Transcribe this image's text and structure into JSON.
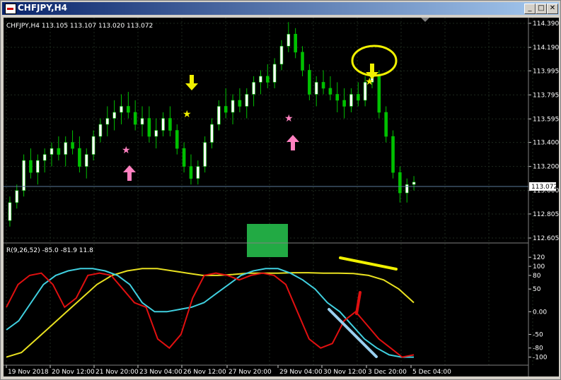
{
  "window": {
    "title": "CHFJPY,H4",
    "buttons": {
      "minimize": "_",
      "maximize": "□",
      "close": "✕"
    }
  },
  "main_chart": {
    "header": "CHFJPY,H4  113.105 113.107 113.020 113.072",
    "price_labels": [
      "114.390",
      "114.190",
      "113.995",
      "113.795",
      "113.595",
      "113.400",
      "113.200",
      "113.000",
      "112.805",
      "112.605"
    ],
    "current_price": "113.072"
  },
  "indicator": {
    "header": "R(9,26,52) -85.0 -81.9 11.8",
    "scale_labels": [
      "120",
      "100",
      "80",
      "50",
      "0.00",
      "-50",
      "-80",
      "-100"
    ]
  },
  "time_axis": [
    "19 Nov 2018",
    "20 Nov 12:00",
    "21 Nov 20:00",
    "23 Nov 04:00",
    "26 Nov 12:00",
    "27 Nov 20:00",
    "29 Nov 04:00",
    "30 Nov 12:00",
    "3 Dec 20:00",
    "5 Dec 04:00"
  ],
  "colors": {
    "background": "#000000",
    "grid": "#1e2a1e",
    "bull_candle": "#ffffff",
    "bear_candle": "#00c000",
    "wick": "#00c000",
    "osc_fast": "#e01010",
    "osc_mid": "#40d0e0",
    "osc_slow": "#e8e020",
    "arrow_up": "#ff80c0",
    "arrow_down": "#f0f000",
    "marker_box": "#22aa44"
  },
  "chart_data": {
    "type": "candlestick",
    "ylim": [
      112.605,
      114.39
    ],
    "candles": [
      [
        112.75,
        112.95,
        112.7,
        112.9
      ],
      [
        112.9,
        113.05,
        112.85,
        113.0
      ],
      [
        113.0,
        113.3,
        112.95,
        113.25
      ],
      [
        113.25,
        113.35,
        113.1,
        113.15
      ],
      [
        113.15,
        113.3,
        113.05,
        113.25
      ],
      [
        113.25,
        113.35,
        113.15,
        113.3
      ],
      [
        113.3,
        113.4,
        113.2,
        113.35
      ],
      [
        113.35,
        113.45,
        113.25,
        113.3
      ],
      [
        113.3,
        113.45,
        113.2,
        113.4
      ],
      [
        113.4,
        113.5,
        113.3,
        113.35
      ],
      [
        113.35,
        113.45,
        113.15,
        113.2
      ],
      [
        113.2,
        113.35,
        113.1,
        113.3
      ],
      [
        113.3,
        113.5,
        113.25,
        113.45
      ],
      [
        113.45,
        113.6,
        113.4,
        113.55
      ],
      [
        113.55,
        113.7,
        113.45,
        113.6
      ],
      [
        113.6,
        113.75,
        113.5,
        113.65
      ],
      [
        113.65,
        113.8,
        113.55,
        113.7
      ],
      [
        113.7,
        113.82,
        113.6,
        113.65
      ],
      [
        113.65,
        113.75,
        113.5,
        113.55
      ],
      [
        113.55,
        113.7,
        113.45,
        113.6
      ],
      [
        113.6,
        113.7,
        113.4,
        113.45
      ],
      [
        113.45,
        113.6,
        113.35,
        113.5
      ],
      [
        113.5,
        113.65,
        113.45,
        113.6
      ],
      [
        113.6,
        113.7,
        113.45,
        113.5
      ],
      [
        113.5,
        113.55,
        113.3,
        113.35
      ],
      [
        113.35,
        113.4,
        113.15,
        113.2
      ],
      [
        113.2,
        113.3,
        113.05,
        113.1
      ],
      [
        113.1,
        113.25,
        113.05,
        113.2
      ],
      [
        113.2,
        113.45,
        113.15,
        113.4
      ],
      [
        113.4,
        113.6,
        113.35,
        113.55
      ],
      [
        113.55,
        113.75,
        113.5,
        113.7
      ],
      [
        113.7,
        113.85,
        113.6,
        113.65
      ],
      [
        113.65,
        113.8,
        113.55,
        113.75
      ],
      [
        113.75,
        113.85,
        113.65,
        113.7
      ],
      [
        113.7,
        113.85,
        113.6,
        113.8
      ],
      [
        113.8,
        113.95,
        113.7,
        113.9
      ],
      [
        113.9,
        114.0,
        113.8,
        113.95
      ],
      [
        113.95,
        114.05,
        113.85,
        113.9
      ],
      [
        113.9,
        114.1,
        113.85,
        114.05
      ],
      [
        114.05,
        114.25,
        114.0,
        114.2
      ],
      [
        114.2,
        114.4,
        114.15,
        114.3
      ],
      [
        114.3,
        114.35,
        114.1,
        114.15
      ],
      [
        114.15,
        114.2,
        113.95,
        114.0
      ],
      [
        114.0,
        114.05,
        113.75,
        113.8
      ],
      [
        113.8,
        113.95,
        113.7,
        113.9
      ],
      [
        113.9,
        114.0,
        113.8,
        113.85
      ],
      [
        113.85,
        113.95,
        113.75,
        113.8
      ],
      [
        113.8,
        113.9,
        113.65,
        113.75
      ],
      [
        113.75,
        113.85,
        113.6,
        113.7
      ],
      [
        113.7,
        113.85,
        113.65,
        113.8
      ],
      [
        113.8,
        113.9,
        113.7,
        113.75
      ],
      [
        113.75,
        113.95,
        113.7,
        113.9
      ],
      [
        113.9,
        114.0,
        113.85,
        113.95
      ],
      [
        113.95,
        114.0,
        113.6,
        113.65
      ],
      [
        113.65,
        113.7,
        113.4,
        113.45
      ],
      [
        113.45,
        113.5,
        113.1,
        113.15
      ],
      [
        113.15,
        113.2,
        112.9,
        112.98
      ],
      [
        112.98,
        113.1,
        112.9,
        113.05
      ],
      [
        113.05,
        113.12,
        113.0,
        113.07
      ]
    ]
  },
  "oscillator_data": {
    "fast": [
      10,
      60,
      80,
      85,
      60,
      10,
      30,
      80,
      85,
      80,
      50,
      20,
      10,
      -60,
      -80,
      -50,
      30,
      80,
      85,
      80,
      70,
      80,
      85,
      80,
      60,
      0,
      -60,
      -80,
      -70,
      -20,
      0,
      -30,
      -60,
      -80,
      -100,
      -95
    ],
    "mid": [
      -40,
      -20,
      20,
      60,
      80,
      90,
      95,
      95,
      90,
      80,
      60,
      20,
      0,
      0,
      5,
      10,
      20,
      40,
      60,
      80,
      90,
      95,
      95,
      85,
      70,
      50,
      20,
      0,
      -30,
      -60,
      -80,
      -95,
      -100,
      -100
    ],
    "slow": [
      -100,
      -90,
      -60,
      -30,
      0,
      30,
      60,
      80,
      90,
      95,
      95,
      90,
      85,
      80,
      80,
      82,
      85,
      85,
      85,
      86,
      86,
      85,
      85,
      84,
      80,
      70,
      50,
      20
    ]
  }
}
